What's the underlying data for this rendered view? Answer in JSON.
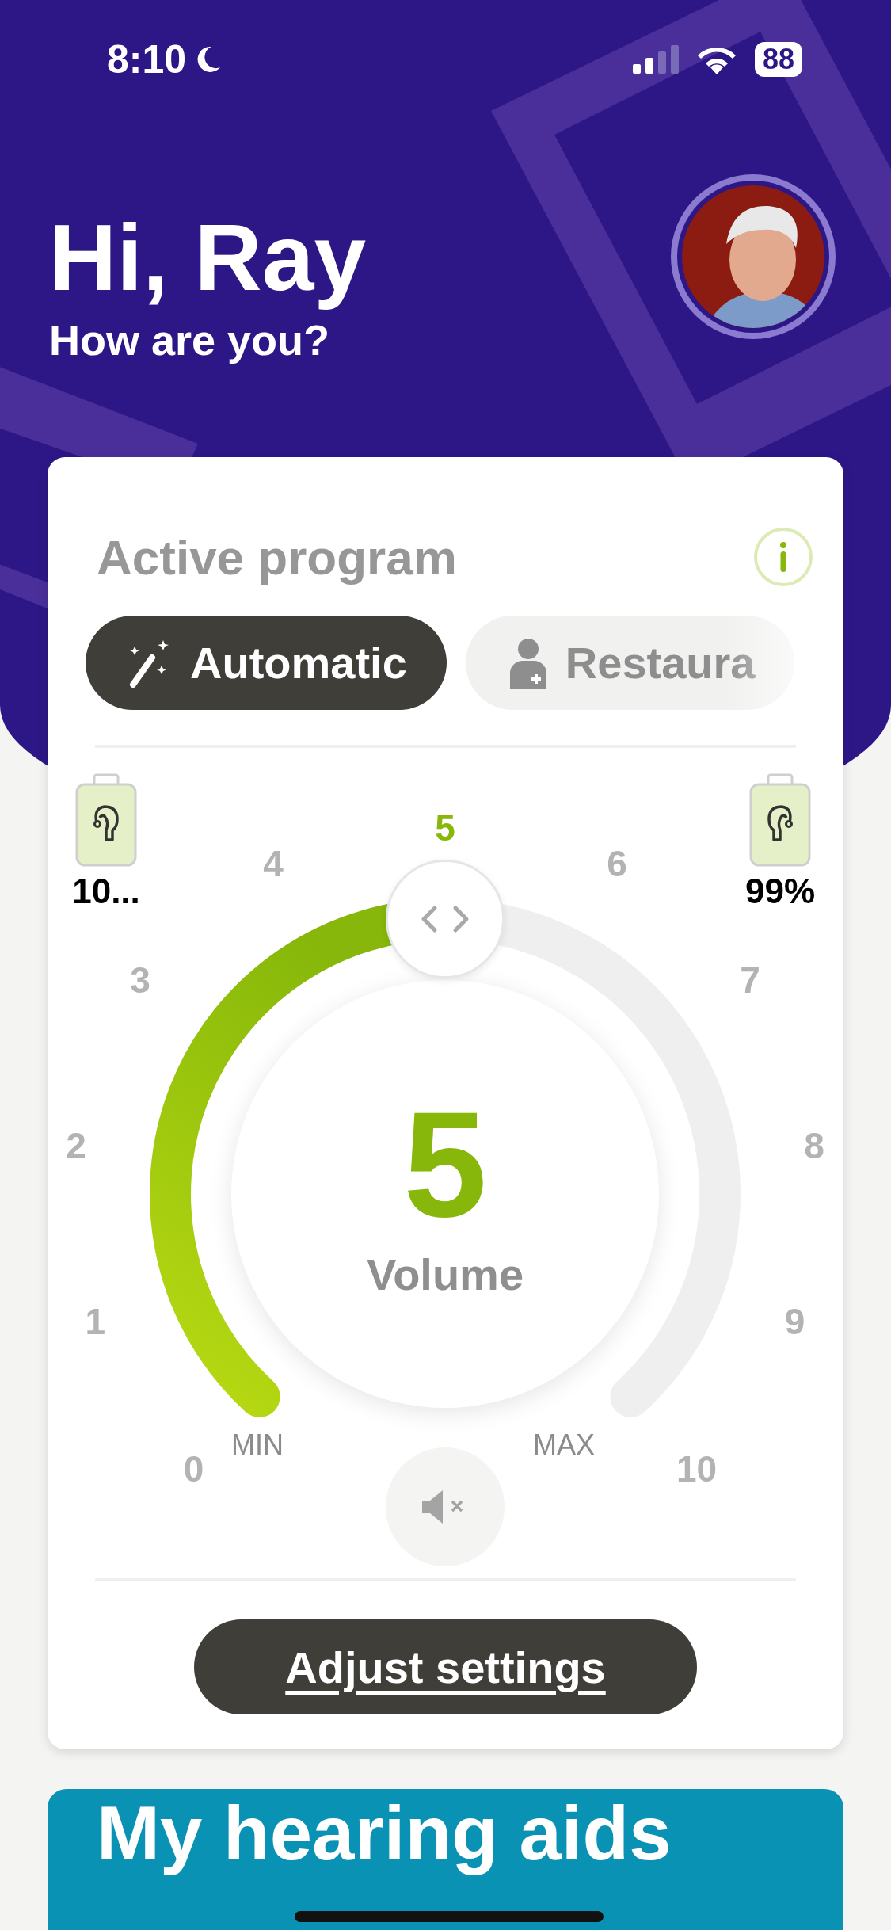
{
  "status_bar": {
    "time": "8:10",
    "battery": "88"
  },
  "greeting": {
    "title": "Hi, Ray",
    "subtitle": "How are you?"
  },
  "program_card": {
    "title": "Active program",
    "programs": [
      {
        "label": "Automatic",
        "kind": "automatic",
        "selected": true
      },
      {
        "label": "Restaura",
        "kind": "custom",
        "selected": false
      }
    ],
    "hearing_aids": [
      {
        "battery": "10..."
      },
      {
        "battery": "99%"
      }
    ],
    "volume": {
      "value": "5",
      "label": "Volume",
      "scale": [
        {
          "label": "0",
          "selected": false
        },
        {
          "label": "1",
          "selected": false
        },
        {
          "label": "2",
          "selected": false
        },
        {
          "label": "3",
          "selected": false
        },
        {
          "label": "4",
          "selected": false
        },
        {
          "label": "5",
          "selected": true
        },
        {
          "label": "6",
          "selected": false
        },
        {
          "label": "7",
          "selected": false
        },
        {
          "label": "8",
          "selected": false
        },
        {
          "label": "9",
          "selected": false
        },
        {
          "label": "10",
          "selected": false
        }
      ],
      "min_label": "MIN",
      "max_label": "MAX",
      "muted": false
    },
    "button": "Adjust settings"
  },
  "hearing_aids_card": {
    "title": "My hearing aids"
  }
}
